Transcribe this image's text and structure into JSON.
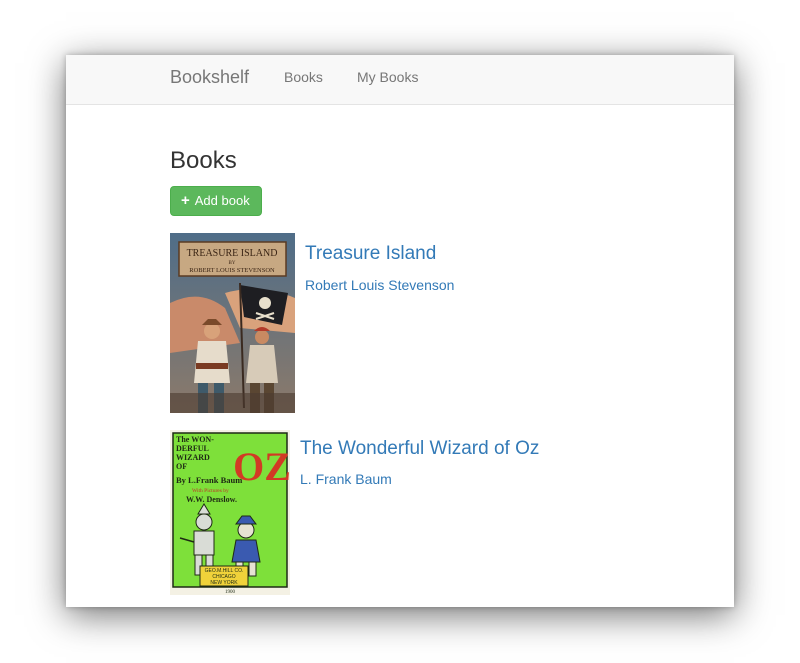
{
  "navbar": {
    "brand": "Bookshelf",
    "links": [
      {
        "label": "Books"
      },
      {
        "label": "My Books"
      }
    ]
  },
  "main": {
    "title": "Books",
    "add_button_label": "Add book",
    "add_button_icon": "plus-icon",
    "books": [
      {
        "title": "Treasure Island",
        "author": "Robert Louis Stevenson",
        "cover_text": [
          "TREASURE ISLAND",
          "BY",
          "ROBERT LOUIS STEVENSON"
        ]
      },
      {
        "title": "The Wonderful Wizard of Oz",
        "author": "L. Frank Baum",
        "cover_text": [
          "The WON-",
          "DERFUL",
          "WIZARD",
          "OF",
          "OZ",
          "By L.Frank Baum",
          "With Pictures by",
          "W.W. Denslow.",
          "GEO.M.HILL CO.",
          "CHICAGO",
          "NEW YORK",
          "1900"
        ]
      }
    ]
  },
  "colors": {
    "navbar_bg": "#f8f8f8",
    "link_blue": "#337ab7",
    "success_green": "#5cb85c",
    "muted_text": "#777777",
    "cover_green": "#7ee03a"
  }
}
